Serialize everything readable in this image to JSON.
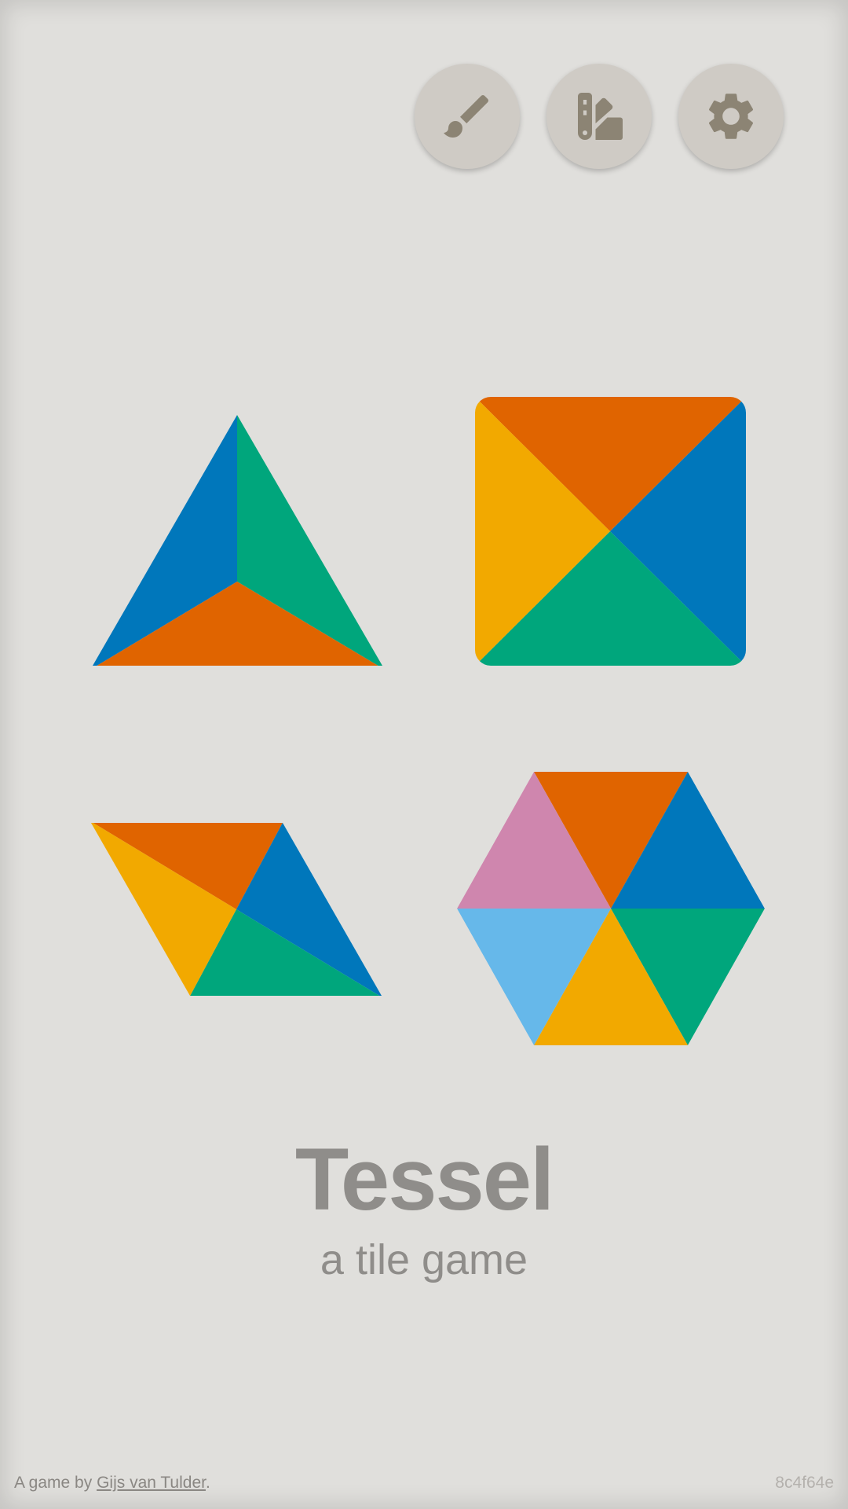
{
  "toolbar": {
    "buttons": [
      {
        "icon": "paintbrush-icon"
      },
      {
        "icon": "palette-swatch-icon"
      },
      {
        "icon": "gear-icon"
      }
    ],
    "icon_color": "#8c8474",
    "button_color": "#cfcbc5"
  },
  "tiles": [
    {
      "shape": "triangle",
      "colors": [
        "#0077bb",
        "#00a67c",
        "#e06400"
      ]
    },
    {
      "shape": "square",
      "colors": [
        "#e06400",
        "#0077bb",
        "#00a67c",
        "#f2a900"
      ]
    },
    {
      "shape": "rhombus",
      "colors": [
        "#e06400",
        "#0077bb",
        "#00a67c",
        "#f2a900"
      ]
    },
    {
      "shape": "hexagon",
      "colors": [
        "#e06400",
        "#0077bb",
        "#00a67c",
        "#f2a900",
        "#66b8ea",
        "#cf86ae"
      ]
    }
  ],
  "title": "Tessel",
  "subtitle": "a tile game",
  "footer": {
    "credit_prefix": "A game by ",
    "author": "Gijs van Tulder",
    "credit_suffix": ".",
    "version": "8c4f64e"
  },
  "colors": {
    "background": "#e0dfdc",
    "text": "#8f8d8a"
  }
}
